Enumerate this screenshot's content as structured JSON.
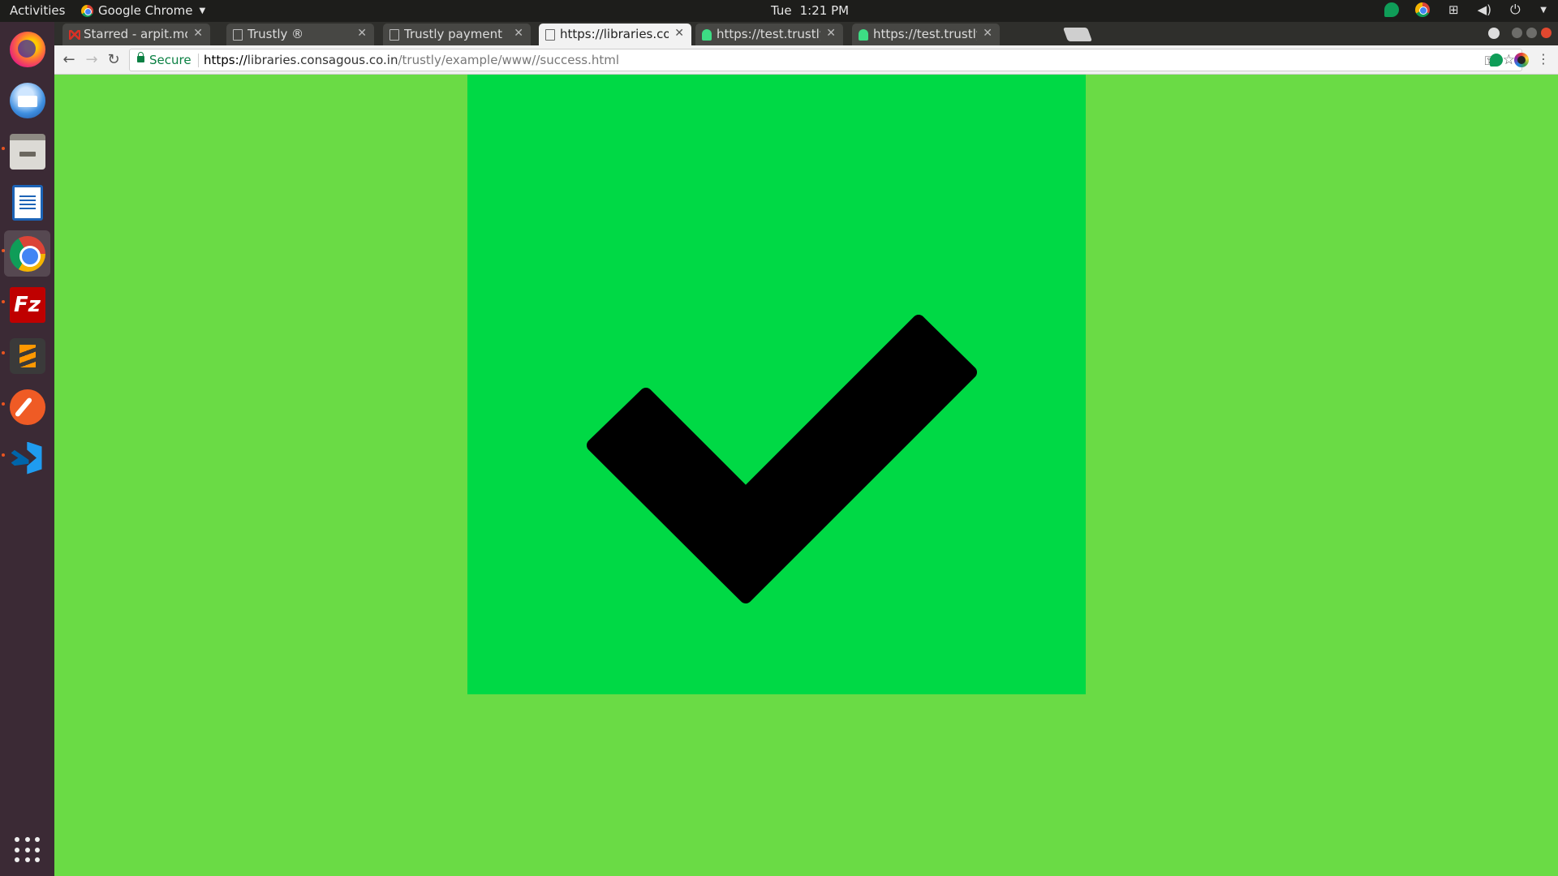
{
  "topbar": {
    "activities": "Activities",
    "app_name": "Google Chrome",
    "day": "Tue",
    "time": "1:21 PM"
  },
  "dock": {
    "items": [
      {
        "name": "firefox-icon",
        "running": false
      },
      {
        "name": "thunderbird-icon",
        "running": false
      },
      {
        "name": "files-icon",
        "running": true
      },
      {
        "name": "libreoffice-writer-icon",
        "running": false
      },
      {
        "name": "chrome-icon",
        "running": true,
        "active": true
      },
      {
        "name": "filezilla-icon",
        "running": true
      },
      {
        "name": "sublime-text-icon",
        "running": true
      },
      {
        "name": "postman-icon",
        "running": true
      },
      {
        "name": "vscode-icon",
        "running": true
      }
    ],
    "filezilla_glyph": "Fz"
  },
  "tabs": [
    {
      "label": "Starred - arpit.mou",
      "favicon": "gmail",
      "active": false
    },
    {
      "label": "Trustly ®",
      "favicon": "page",
      "active": false
    },
    {
      "label": "Trustly payment",
      "favicon": "page",
      "active": false
    },
    {
      "label": "https://libraries.co",
      "favicon": "page",
      "active": true
    },
    {
      "label": "https://test.trustly",
      "favicon": "android",
      "active": false
    },
    {
      "label": "https://test.trustly",
      "favicon": "android",
      "active": false
    }
  ],
  "toolbar": {
    "secure_label": "Secure",
    "url_scheme": "https://",
    "url_host": "libraries.consagous.co.in",
    "url_path": "/trustly/example/www//success.html"
  },
  "page": {
    "background_color": "#6adb45",
    "box_color": "#00d945",
    "check_color": "#000000"
  }
}
